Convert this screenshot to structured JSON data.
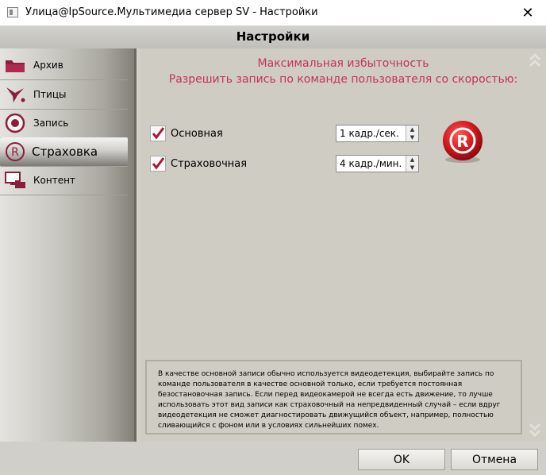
{
  "window": {
    "title": "Улица@IpSource.Мультимедиа сервер SV - Настройки",
    "close_glyph": "✕"
  },
  "header": {
    "title": "Настройки"
  },
  "sidebar": {
    "items": [
      {
        "label": "Архив",
        "icon": "folder-icon"
      },
      {
        "label": "Птицы",
        "icon": "birds-icon"
      },
      {
        "label": "Запись",
        "icon": "record-icon"
      },
      {
        "label": "Страховка",
        "icon": "registered-icon",
        "selected": true
      },
      {
        "label": "Контент",
        "icon": "content-icon"
      }
    ]
  },
  "main": {
    "heading1": "Максимальная избыточность",
    "heading2": "Разрешить запись по команде пользователя со скоростью:",
    "rows": [
      {
        "label": "Основная",
        "checked": true,
        "value": "1 кадр./сек."
      },
      {
        "label": "Страховочная",
        "checked": true,
        "value": "4 кадр./мин."
      }
    ],
    "badge_glyph": "R",
    "info": "В качестве основной записи обычно используется видеодетекция, выбирайте запись по команде пользователя в качестве основной только, если требуется постоянная безостановочная запись. Если перед видеокамерой не всегда есть движение, то лучше использовать этот вид записи как страховочный на непредвиденный случай – если вдруг видеодетекция не сможет диагностировать движущийся объект, например, полностью сливающийся с фоном или в условиях сильнейших помех."
  },
  "footer": {
    "ok_label": "OK",
    "cancel_label": "Отмена"
  },
  "colors": {
    "accent": "#c8315b",
    "badge_red": "#c8171c",
    "check": "#b0143a"
  }
}
